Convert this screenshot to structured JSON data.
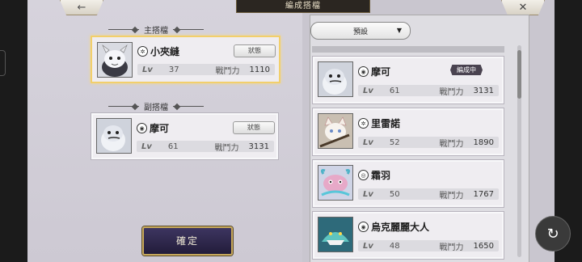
{
  "header": {
    "title": "編成搭檔"
  },
  "nav": {
    "back_icon": "←",
    "close_icon": "✕"
  },
  "main_slot": {
    "label": "主搭檔",
    "name": "小夾縫",
    "lv_label": "Lv",
    "lv": "37",
    "power_label": "戰鬥力",
    "power": "1110",
    "status_button": "狀態"
  },
  "sub_slot": {
    "label": "副搭檔",
    "name": "摩可",
    "lv_label": "Lv",
    "lv": "61",
    "power_label": "戰鬥力",
    "power": "3131",
    "status_button": "狀態"
  },
  "confirm_button": "確定",
  "filter": {
    "selected": "預設",
    "arrow": "▼"
  },
  "list": [
    {
      "name": "摩可",
      "lv_label": "Lv",
      "lv": "61",
      "power_label": "戰鬥力",
      "power": "3131",
      "badge": "編成中",
      "portrait": "white-seal"
    },
    {
      "name": "里雷諾",
      "lv_label": "Lv",
      "lv": "52",
      "power_label": "戰鬥力",
      "power": "1890",
      "badge": "",
      "portrait": "white-cat"
    },
    {
      "name": "霜羽",
      "lv_label": "Lv",
      "lv": "50",
      "power_label": "戰鬥力",
      "power": "1767",
      "badge": "",
      "portrait": "pink-axolotl"
    },
    {
      "name": "烏克麗麗大人",
      "lv_label": "Lv",
      "lv": "48",
      "power_label": "戰鬥力",
      "power": "1650",
      "badge": "",
      "portrait": "teal-shark"
    }
  ],
  "fab_icon": "refresh-icon",
  "colors": {
    "selected_border": "#f2cf6b",
    "badge_bg": "#4a4350",
    "confirm_bg": "#2c2548",
    "confirm_border": "#c7a95c"
  }
}
